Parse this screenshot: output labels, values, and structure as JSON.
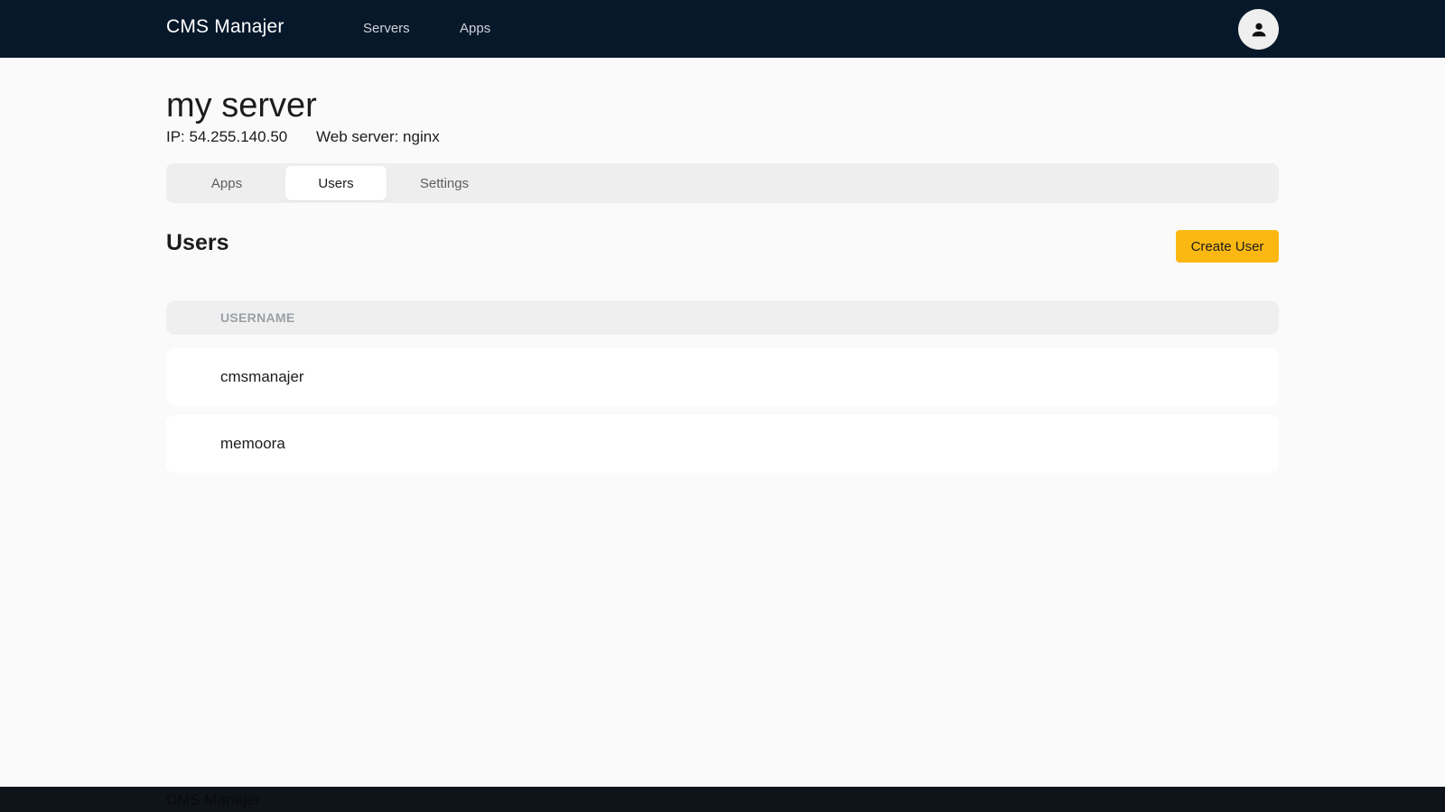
{
  "header": {
    "brand": "CMS Manajer",
    "nav": [
      {
        "label": "Servers"
      },
      {
        "label": "Apps"
      }
    ],
    "avatar_icon": "user-icon"
  },
  "server": {
    "name": "my server",
    "ip": "IP: 54.255.140.50",
    "web_server": "Web server: nginx"
  },
  "tabs": [
    {
      "label": "Apps",
      "active": false
    },
    {
      "label": "Users",
      "active": true
    },
    {
      "label": "Settings",
      "active": false
    }
  ],
  "users_section": {
    "title": "Users",
    "create_label": "Create User",
    "create_color": "#fbb812",
    "columns": [
      "USERNAME"
    ],
    "rows": [
      {
        "username": "cmsmanajer"
      },
      {
        "username": "memoora"
      }
    ]
  },
  "footer": {
    "text": "CMS Manajer"
  }
}
